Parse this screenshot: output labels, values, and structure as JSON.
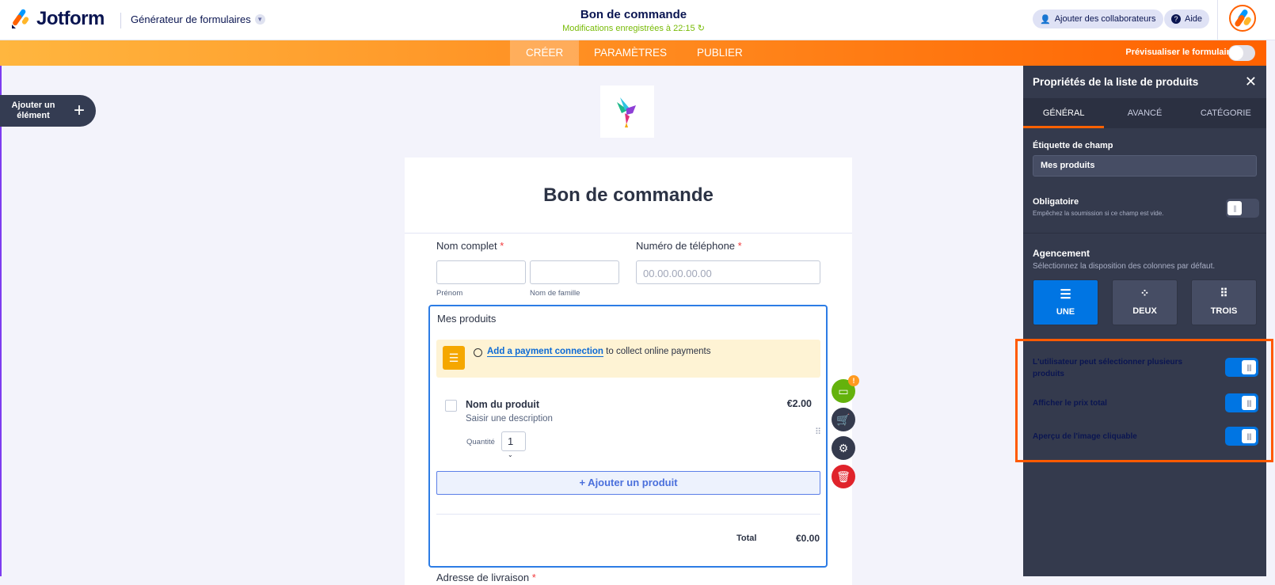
{
  "header": {
    "brand": "Jotform",
    "app_switcher": "Générateur de formulaires",
    "form_title": "Bon de commande",
    "save_status": "Modifications enregistrées à 22:15",
    "collab_button": "Ajouter des collaborateurs",
    "help_button": "Aide"
  },
  "nav": {
    "tabs": [
      "CRÉER",
      "PARAMÈTRES",
      "PUBLIER"
    ],
    "active": "CRÉER",
    "preview_label": "Prévisualiser le formulaire",
    "preview_on": false
  },
  "left": {
    "add_element": "Ajouter un élément"
  },
  "form": {
    "title": "Bon de commande",
    "full_name": {
      "label": "Nom complet",
      "required": "*",
      "first_sub": "Prénom",
      "last_sub": "Nom de famille"
    },
    "phone": {
      "label": "Numéro de téléphone",
      "required": "*",
      "placeholder": "00.00.00.00.00"
    },
    "products": {
      "label": "Mes produits",
      "banner_link": "Add a payment connection",
      "banner_text": "to collect online payments",
      "product_name": "Nom du produit",
      "product_desc": "Saisir une description",
      "product_price": "€2.00",
      "qty_label": "Quantité",
      "qty_value": "1",
      "add_product": "+ Ajouter un produit",
      "total_label": "Total",
      "total_value": "€0.00",
      "badge": "!"
    },
    "next_field": {
      "label": "Adresse de livraison",
      "required": "*"
    }
  },
  "panel": {
    "title": "Propriétés de la liste de produits",
    "tabs": [
      "GÉNÉRAL",
      "AVANCÉ",
      "CATÉGORIE"
    ],
    "active_tab": "GÉNÉRAL",
    "field_label_title": "Étiquette de champ",
    "field_label_value": "Mes produits",
    "required_title": "Obligatoire",
    "required_desc": "Empêchez la soumission si ce champ est vide.",
    "required_on": false,
    "layout_title": "Agencement",
    "layout_desc": "Sélectionnez la disposition des colonnes par défaut.",
    "layout_options": [
      "UNE",
      "DEUX",
      "TROIS"
    ],
    "layout_selected": "UNE",
    "options": [
      {
        "label": "L'utilisateur peut sélectionner plusieurs produits",
        "on": true
      },
      {
        "label": "Afficher le prix total",
        "on": true
      },
      {
        "label": "Aperçu de l'image cliquable",
        "on": true
      }
    ]
  },
  "colors": {
    "accent": "#ff6100",
    "primary": "#0075e3",
    "panel": "#343a4d",
    "highlight": "#ff5a00"
  }
}
